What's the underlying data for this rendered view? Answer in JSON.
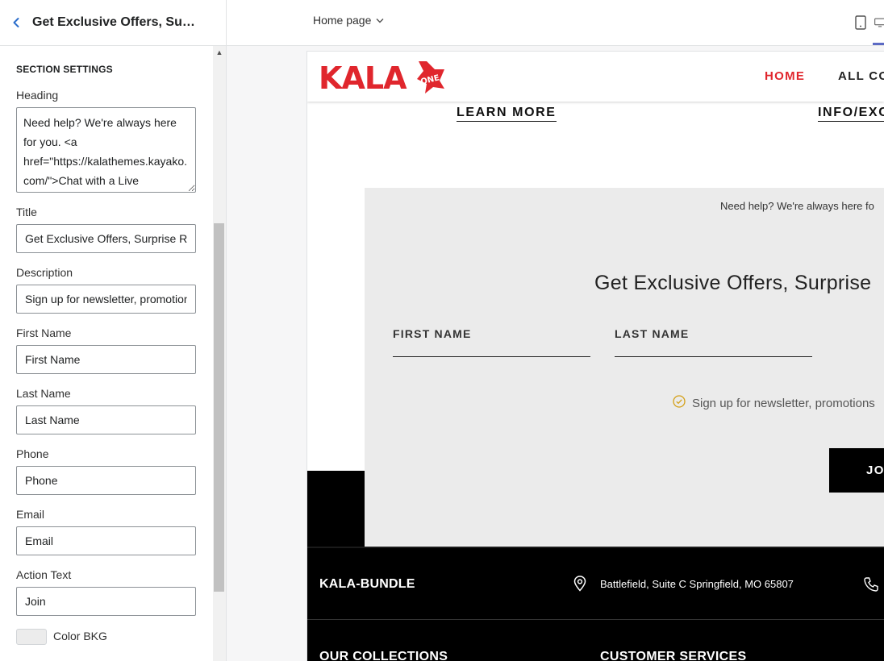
{
  "sidebar": {
    "header_title": "Get Exclusive Offers, Surp...",
    "section_label": "SECTION SETTINGS",
    "fields": {
      "heading": {
        "label": "Heading",
        "value": "Need help? We're always here for you. <a href=\"https://kalathemes.kayako.com/\">Chat with a Live"
      },
      "title": {
        "label": "Title",
        "value": "Get Exclusive Offers, Surprise Re"
      },
      "description": {
        "label": "Description",
        "value": "Sign up for newsletter, promotion"
      },
      "first_name": {
        "label": "First Name",
        "value": "First Name"
      },
      "last_name": {
        "label": "Last Name",
        "value": "Last Name"
      },
      "phone": {
        "label": "Phone",
        "value": "Phone"
      },
      "email": {
        "label": "Email",
        "value": "Email"
      },
      "action_text": {
        "label": "Action Text",
        "value": "Join"
      },
      "color_bkg": {
        "label": "Color BKG",
        "value": "#ececec"
      }
    }
  },
  "topbar": {
    "page_selector": "Home page",
    "accent": "#5c6ac4"
  },
  "preview": {
    "logo_text": "KALA",
    "logo_badge": "ONE",
    "nav": [
      "HOME",
      "ALL CO"
    ],
    "links": [
      "LEARN MORE",
      "INFO/EXC"
    ],
    "newsletter": {
      "help_text": "Need help? We're always here fo",
      "title": "Get Exclusive Offers, Surprise",
      "first_name": "FIRST NAME",
      "last_name": "LAST NAME",
      "description": "Sign up for newsletter, promotions",
      "join": "JOI",
      "background": "#ebebeb"
    },
    "footer": {
      "brand": "KALA-BUNDLE",
      "address": "Battlefield, Suite C Springfield, MO 65807",
      "columns": [
        "OUR COLLECTIONS",
        "CUSTOMER SERVICES"
      ]
    },
    "colors": {
      "brand_red": "#e0262d",
      "check_gold": "#d4a017"
    }
  }
}
